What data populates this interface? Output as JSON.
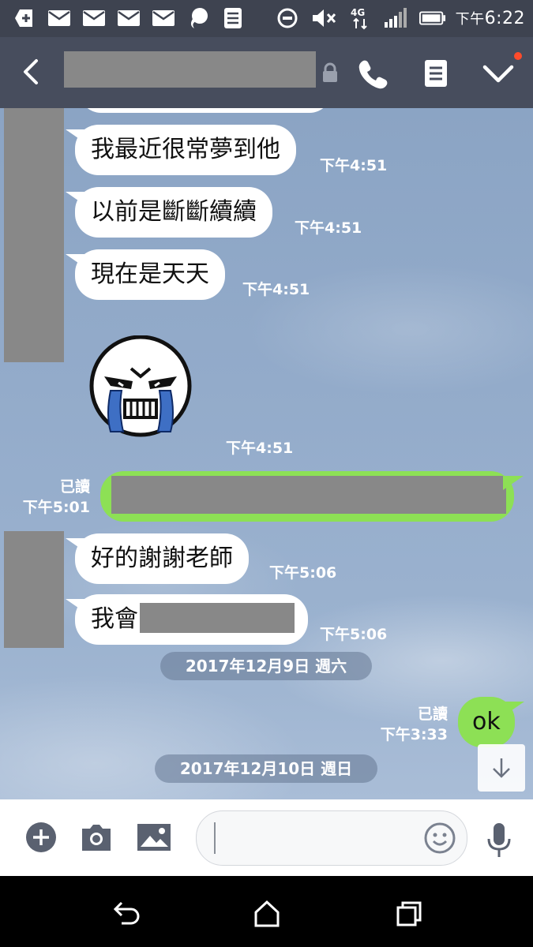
{
  "status_bar": {
    "time_prefix": "下午",
    "time": "6:22",
    "network": "4G",
    "icons": [
      "plus-icon",
      "mail-icon",
      "mail-icon",
      "mail-icon",
      "mail-icon",
      "chat-bubble-icon",
      "list-icon",
      "do-not-disturb-icon",
      "mute-icon",
      "signal-icon",
      "battery-icon"
    ]
  },
  "header": {
    "title": "",
    "actions": [
      "call-icon",
      "notes-icon",
      "menu-check-icon"
    ]
  },
  "messages": {
    "m1": {
      "text": "我最近很常夢到他",
      "time": "下午4:51"
    },
    "m2": {
      "text": "以前是斷斷續續",
      "time": "下午4:51"
    },
    "m3": {
      "text": "現在是天天",
      "time": "下午4:51"
    },
    "sticker": {
      "time": "下午4:51"
    },
    "out1": {
      "read": "已讀",
      "time": "下午5:01"
    },
    "m4": {
      "text": "好的謝謝老師",
      "time": "下午5:06"
    },
    "m5": {
      "text": "我會",
      "time": "下午5:06"
    },
    "date1": "2017年12月9日 週六",
    "out2": {
      "text": "ok",
      "read": "已讀",
      "time": "下午3:33"
    },
    "date2": "2017年12月10日 週日"
  },
  "colors": {
    "header": "#474d5d",
    "status_bar": "#3e4350",
    "outgoing_bubble": "#8de055",
    "incoming_bubble": "#ffffff"
  }
}
